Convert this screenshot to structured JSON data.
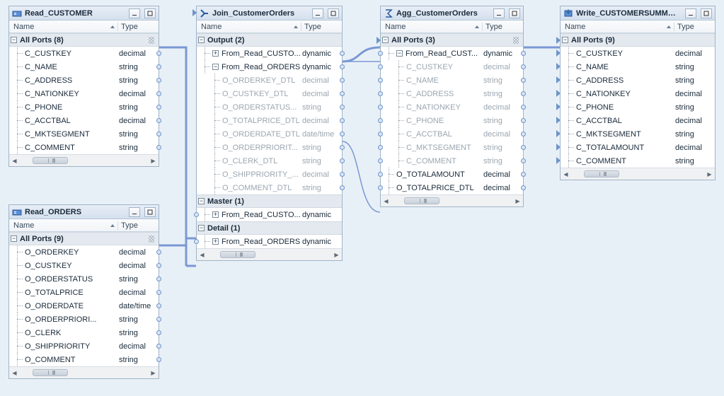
{
  "columns": {
    "name_label": "Name",
    "type_label": "Type"
  },
  "panels": {
    "read_customer": {
      "title": "Read_CUSTOMER",
      "all_ports": "All Ports (8)",
      "fields": [
        {
          "name": "C_CUSTKEY",
          "type": "decimal"
        },
        {
          "name": "C_NAME",
          "type": "string"
        },
        {
          "name": "C_ADDRESS",
          "type": "string"
        },
        {
          "name": "C_NATIONKEY",
          "type": "decimal"
        },
        {
          "name": "C_PHONE",
          "type": "string"
        },
        {
          "name": "C_ACCTBAL",
          "type": "decimal"
        },
        {
          "name": "C_MKTSEGMENT",
          "type": "string"
        },
        {
          "name": "C_COMMENT",
          "type": "string"
        }
      ]
    },
    "read_orders": {
      "title": "Read_ORDERS",
      "all_ports": "All Ports (9)",
      "fields": [
        {
          "name": "O_ORDERKEY",
          "type": "decimal"
        },
        {
          "name": "O_CUSTKEY",
          "type": "decimal"
        },
        {
          "name": "O_ORDERSTATUS",
          "type": "string"
        },
        {
          "name": "O_TOTALPRICE",
          "type": "decimal"
        },
        {
          "name": "O_ORDERDATE",
          "type": "date/time"
        },
        {
          "name": "O_ORDERPRIORI...",
          "type": "string"
        },
        {
          "name": "O_CLERK",
          "type": "string"
        },
        {
          "name": "O_SHIPPRIORITY",
          "type": "decimal"
        },
        {
          "name": "O_COMMENT",
          "type": "string"
        }
      ]
    },
    "join": {
      "title": "Join_CustomerOrders",
      "output": "Output (2)",
      "from_customer": {
        "name": "From_Read_CUSTO...",
        "type": "dynamic"
      },
      "from_orders_hdr": {
        "name": "From_Read_ORDERS",
        "type": "dynamic"
      },
      "order_detail": [
        {
          "name": "O_ORDERKEY_DTL",
          "type": "decimal"
        },
        {
          "name": "O_CUSTKEY_DTL",
          "type": "decimal"
        },
        {
          "name": "O_ORDERSTATUS...",
          "type": "string"
        },
        {
          "name": "O_TOTALPRICE_DTL",
          "type": "decimal"
        },
        {
          "name": "O_ORDERDATE_DTL",
          "type": "date/time"
        },
        {
          "name": "O_ORDERPRIORIT...",
          "type": "string"
        },
        {
          "name": "O_CLERK_DTL",
          "type": "string"
        },
        {
          "name": "O_SHIPPRIORITY_...",
          "type": "decimal"
        },
        {
          "name": "O_COMMENT_DTL",
          "type": "string"
        }
      ],
      "master": "Master (1)",
      "master_from": {
        "name": "From_Read_CUSTO...",
        "type": "dynamic"
      },
      "detail": "Detail (1)",
      "detail_from": {
        "name": "From_Read_ORDERS",
        "type": "dynamic"
      }
    },
    "agg": {
      "title": "Agg_CustomerOrders",
      "all_ports": "All Ports (3)",
      "from_customer": {
        "name": "From_Read_CUST...",
        "type": "dynamic"
      },
      "customer_detail": [
        {
          "name": "C_CUSTKEY",
          "type": "decimal"
        },
        {
          "name": "C_NAME",
          "type": "string"
        },
        {
          "name": "C_ADDRESS",
          "type": "string"
        },
        {
          "name": "C_NATIONKEY",
          "type": "decimal"
        },
        {
          "name": "C_PHONE",
          "type": "string"
        },
        {
          "name": "C_ACCTBAL",
          "type": "decimal"
        },
        {
          "name": "C_MKTSEGMENT",
          "type": "string"
        },
        {
          "name": "C_COMMENT",
          "type": "string"
        }
      ],
      "extras": [
        {
          "name": "O_TOTALAMOUNT",
          "type": "decimal"
        },
        {
          "name": "O_TOTALPRICE_DTL",
          "type": "decimal"
        }
      ]
    },
    "write": {
      "title": "Write_CUSTOMERSUMMARY",
      "all_ports": "All Ports (9)",
      "fields": [
        {
          "name": "C_CUSTKEY",
          "type": "decimal"
        },
        {
          "name": "C_NAME",
          "type": "string"
        },
        {
          "name": "C_ADDRESS",
          "type": "string"
        },
        {
          "name": "C_NATIONKEY",
          "type": "decimal"
        },
        {
          "name": "C_PHONE",
          "type": "string"
        },
        {
          "name": "C_ACCTBAL",
          "type": "decimal"
        },
        {
          "name": "C_MKTSEGMENT",
          "type": "string"
        },
        {
          "name": "C_TOTALAMOUNT",
          "type": "decimal"
        },
        {
          "name": "C_COMMENT",
          "type": "string"
        }
      ]
    }
  }
}
